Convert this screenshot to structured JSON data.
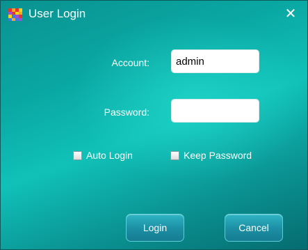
{
  "window": {
    "title": "User Login",
    "close_glyph": "✕",
    "icon_name": "app-icon",
    "close_icon_name": "close-icon"
  },
  "form": {
    "account_label": "Account:",
    "account_value": "admin",
    "password_label": "Password:",
    "password_value": "",
    "auto_login_label": "Auto Login",
    "auto_login_checked": false,
    "keep_password_label": "Keep Password",
    "keep_password_checked": false
  },
  "buttons": {
    "login_label": "Login",
    "cancel_label": "Cancel"
  },
  "colors": {
    "background_accent": "#0aa8a3",
    "button_fill": "#1c8ea3",
    "text": "#ffffff"
  }
}
